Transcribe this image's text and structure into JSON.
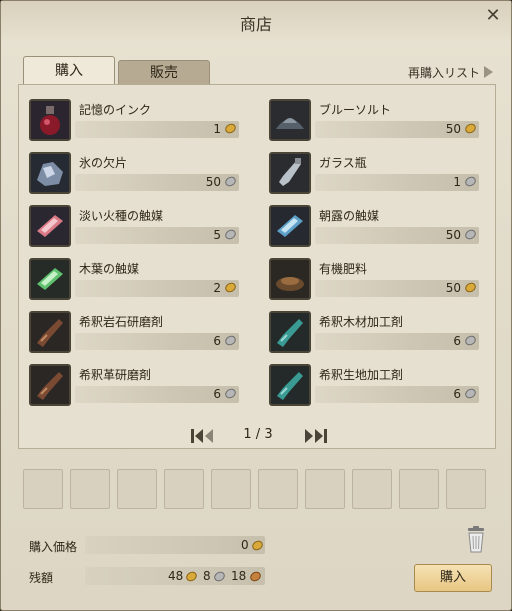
{
  "window": {
    "title": "商店"
  },
  "tabs": [
    {
      "label": "購入",
      "active": true
    },
    {
      "label": "販売",
      "active": false
    }
  ],
  "rebuy_list_label": "再購入リスト",
  "items": [
    {
      "name": "記憶のインク",
      "price": "1",
      "currency": "gold",
      "icon": "red-ink-bottle-icon"
    },
    {
      "name": "ブルーソルト",
      "price": "50",
      "currency": "gold",
      "icon": "blue-salt-pile-icon"
    },
    {
      "name": "氷の欠片",
      "price": "50",
      "currency": "silver",
      "icon": "ice-shard-icon"
    },
    {
      "name": "ガラス瓶",
      "price": "1",
      "currency": "silver",
      "icon": "glass-bottle-icon"
    },
    {
      "name": "淡い火種の触媒",
      "price": "5",
      "currency": "silver",
      "icon": "pink-catalyst-crystal-icon"
    },
    {
      "name": "朝露の触媒",
      "price": "50",
      "currency": "silver",
      "icon": "blue-catalyst-crystal-icon"
    },
    {
      "name": "木葉の触媒",
      "price": "2",
      "currency": "gold",
      "icon": "green-catalyst-crystal-icon"
    },
    {
      "name": "有機肥料",
      "price": "50",
      "currency": "gold",
      "icon": "fertilizer-pile-icon"
    },
    {
      "name": "希釈岩石研磨剤",
      "price": "6",
      "currency": "silver",
      "icon": "brown-polish-brush-icon"
    },
    {
      "name": "希釈木材加工剤",
      "price": "6",
      "currency": "silver",
      "icon": "teal-polish-brush-icon"
    },
    {
      "name": "希釈革研磨剤",
      "price": "6",
      "currency": "silver",
      "icon": "brown-polish-brush-icon"
    },
    {
      "name": "希釈生地加工剤",
      "price": "6",
      "currency": "silver",
      "icon": "teal-polish-brush-icon"
    }
  ],
  "pagination": {
    "text": "1 / 3"
  },
  "purchase_price": {
    "label": "購入価格",
    "value": "0"
  },
  "balance": {
    "label": "残額",
    "gold": "48",
    "silver": "8",
    "copper": "18"
  },
  "buy_button_label": "購入",
  "colors": {
    "gold_coin": "#d9a93a",
    "silver_coin": "#b7b7b7",
    "copper_coin": "#c7813f",
    "buy_button": "#e8c683"
  }
}
